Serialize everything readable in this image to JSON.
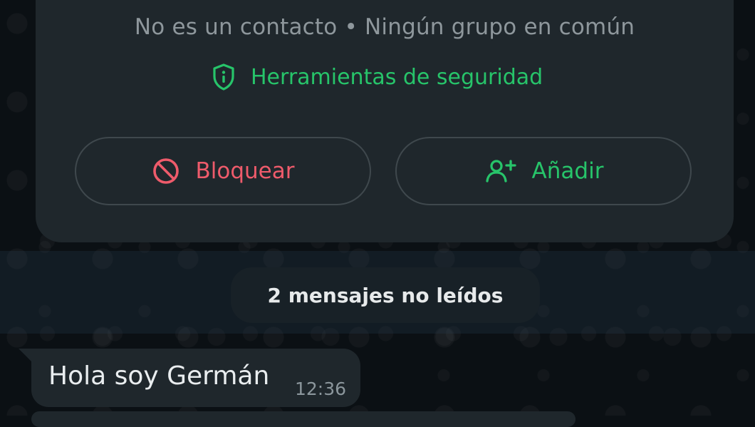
{
  "contact_card": {
    "subtitle": "No es un contacto • Ningún grupo en común",
    "safety_tools_label": "Herramientas de seguridad",
    "block_label": "Bloquear",
    "add_label": "Añadir"
  },
  "unread_notice": "2 mensajes no leídos",
  "message": {
    "text": "Hola soy Germán",
    "time": "12:36"
  },
  "icons": {
    "safety": "shield-icon",
    "block": "block-icon",
    "add": "add-contact-icon"
  },
  "colors": {
    "background": "#0b1014",
    "card": "#1f272c",
    "green": "#27c46a",
    "red": "#ee5b6b",
    "muted_text": "#8e979c"
  }
}
